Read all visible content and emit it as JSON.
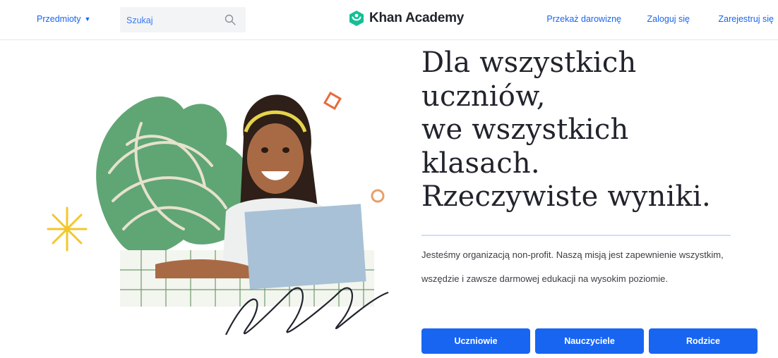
{
  "header": {
    "subjects_label": "Przedmioty",
    "search_placeholder": "Szukaj",
    "logo_text": "Khan Academy",
    "donate_label": "Przekaż darowiznę",
    "login_label": "Zaloguj się",
    "signup_label": "Zarejestruj się"
  },
  "hero": {
    "headline_lines": [
      "Dla wszystkich",
      "uczniów,",
      "we wszystkich",
      "klasach.",
      "Rzeczywiste wyniki."
    ],
    "mission_text": "Jesteśmy organizacją non-profit. Naszą misją jest zapewnienie wszystkim, wszędzie i zawsze darmowej edukacji na wysokim poziomie.",
    "buttons": [
      "Uczniowie",
      "Nauczyciele",
      "Rodzice"
    ]
  },
  "colors": {
    "brand_blue": "#1865f2",
    "logo_green": "#14bf96",
    "leaf_green": "#5fa674",
    "text_dark": "#21242c"
  }
}
